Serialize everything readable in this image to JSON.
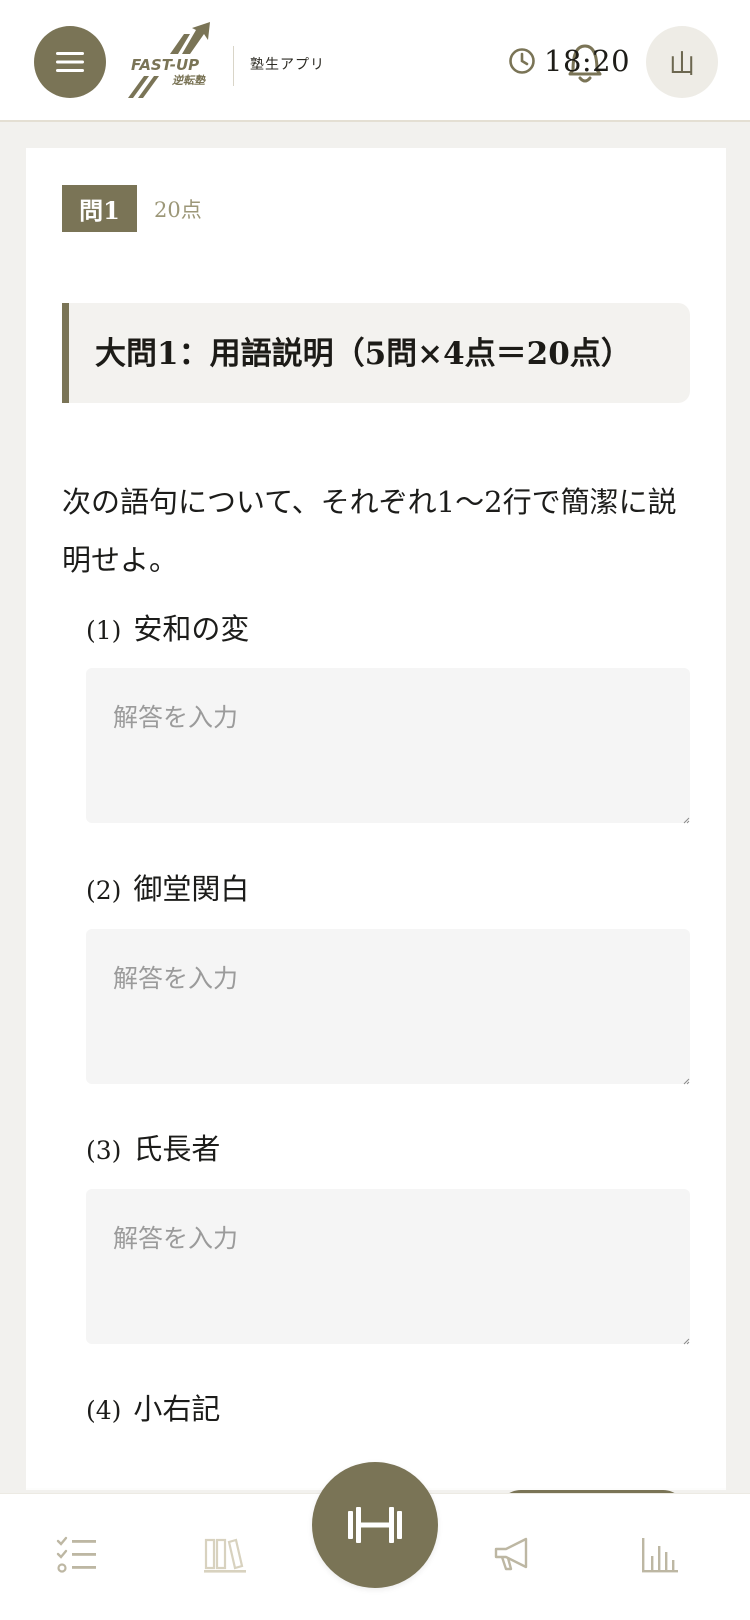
{
  "header": {
    "logo_text": "FAST-UP 逆転塾",
    "app_name": "塾生アプリ",
    "timer": "18:20",
    "avatar_initial": "山"
  },
  "question": {
    "badge": "問1",
    "points": "20点",
    "section_title": "大問1：用語説明（5問×4点＝20点）",
    "instruction": "次の語句について、それぞれ1〜2行で簡潔に説明せよ。",
    "items": [
      {
        "num": "(1)",
        "term": "安和の変",
        "placeholder": "解答を入力",
        "value": ""
      },
      {
        "num": "(2)",
        "term": "御堂関白",
        "placeholder": "解答を入力",
        "value": ""
      },
      {
        "num": "(3)",
        "term": "氏長者",
        "placeholder": "解答を入力",
        "value": ""
      },
      {
        "num": "(4)",
        "term": "小右記"
      }
    ]
  },
  "nav": {
    "items": [
      "checklist-icon",
      "books-icon",
      "dumbbell-icon",
      "megaphone-icon",
      "bar-chart-icon"
    ]
  },
  "colors": {
    "accent": "#7a7456",
    "background": "#f2f1ee",
    "muted_text": "#9c9778"
  }
}
